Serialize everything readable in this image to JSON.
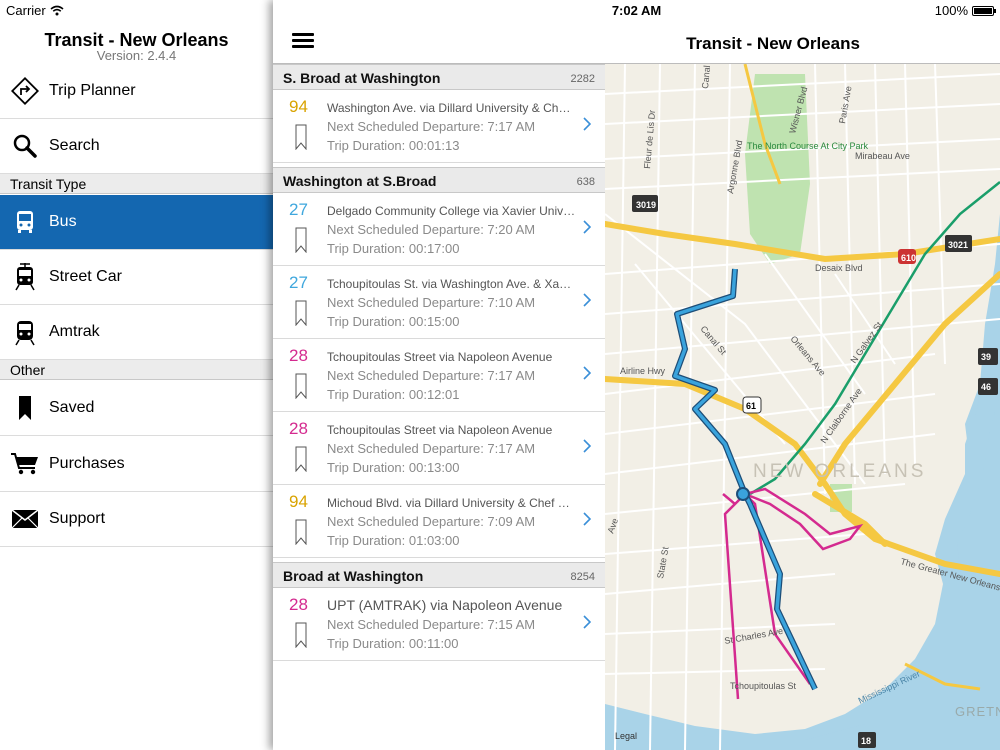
{
  "status": {
    "carrier": "Carrier",
    "time": "7:02 AM",
    "battery": "100%",
    "battery_level": 1.0
  },
  "menu": {
    "app_title": "Transit - New Orleans",
    "version": "Version: 2.4.4",
    "top_items": [
      {
        "label": "Trip Planner",
        "icon": "directions-sign-icon"
      },
      {
        "label": "Search",
        "icon": "search-icon"
      }
    ],
    "transit_type_header": "Transit Type",
    "transit_items": [
      {
        "label": "Bus",
        "icon": "bus-icon",
        "active": true
      },
      {
        "label": "Street Car",
        "icon": "streetcar-icon",
        "active": false
      },
      {
        "label": "Amtrak",
        "icon": "train-icon",
        "active": false
      }
    ],
    "other_header": "Other",
    "other_items": [
      {
        "label": "Saved",
        "icon": "bookmark-icon"
      },
      {
        "label": "Purchases",
        "icon": "cart-icon"
      },
      {
        "label": "Support",
        "icon": "envelope-icon"
      }
    ],
    "active_color": "#1467b0"
  },
  "nav": {
    "title": "Transit - New Orleans"
  },
  "stops": [
    {
      "name": "S. Broad at Washington",
      "id": "2282",
      "routes": [
        {
          "route": "94",
          "color": "#d9a300",
          "destination": "Washington Ave. via Dillard University & Chef Menteur",
          "departure": "Next Scheduled Departure: 7:17 AM",
          "duration": "Trip Duration: 00:01:13"
        }
      ]
    },
    {
      "name": "Washington at S.Broad",
      "id": "638",
      "routes": [
        {
          "route": "27",
          "color": "#3fa7dd",
          "destination": "Delgado Community College via Xavier University",
          "departure": "Next Scheduled Departure: 7:20 AM",
          "duration": "Trip Duration: 00:17:00"
        },
        {
          "route": "27",
          "color": "#3fa7dd",
          "destination": "Tchoupitoulas St. via Washington Ave. & Xavier",
          "departure": "Next Scheduled Departure: 7:10 AM",
          "duration": "Trip Duration: 00:15:00"
        },
        {
          "route": "28",
          "color": "#d42a8f",
          "destination": "Tchoupitoulas Street via Napoleon Avenue",
          "departure": "Next Scheduled Departure: 7:17 AM",
          "duration": "Trip Duration: 00:12:01"
        },
        {
          "route": "28",
          "color": "#d42a8f",
          "destination": "Tchoupitoulas Street via Napoleon Avenue",
          "departure": "Next Scheduled Departure: 7:17 AM",
          "duration": "Trip Duration: 00:13:00"
        },
        {
          "route": "94",
          "color": "#d9a300",
          "destination": "Michoud Blvd. via Dillard University & Chef Menteur",
          "departure": "Next Scheduled Departure: 7:09 AM",
          "duration": "Trip Duration: 01:03:00"
        }
      ]
    },
    {
      "name": "Broad at Washington",
      "id": "8254",
      "routes": [
        {
          "route": "28",
          "color": "#d42a8f",
          "destination": "UPT (AMTRAK) via Napoleon Avenue",
          "departure": "Next Scheduled Departure: 7:15 AM",
          "duration": "Trip Duration: 00:11:00"
        }
      ]
    }
  ],
  "map": {
    "legal": "Legal",
    "city_label": "NEW ORLEANS",
    "gretna_label": "GRETN",
    "river_label": "Mississippi River",
    "street_labels": [
      "Canal",
      "Fleur de Lis Dr",
      "Argonne Blvd",
      "Wisner Blvd",
      "Paris Ave",
      "The North Course At City Park",
      "Mirabeau Ave",
      "Desaix Blvd",
      "Canal St",
      "Orleans Ave",
      "N Galvez St",
      "N Claiborne Ave",
      "Airline Hwy",
      "State St",
      "St Charles Ave",
      "Tchoupitoulas St",
      "The Greater New Orleans",
      "Ave"
    ],
    "shields": [
      "3019",
      "610",
      "3021",
      "61",
      "39",
      "46",
      "18"
    ],
    "route_colors": {
      "blue": "#3aa3dc",
      "magenta": "#d42a8f",
      "green": "#1a9e6a"
    }
  }
}
